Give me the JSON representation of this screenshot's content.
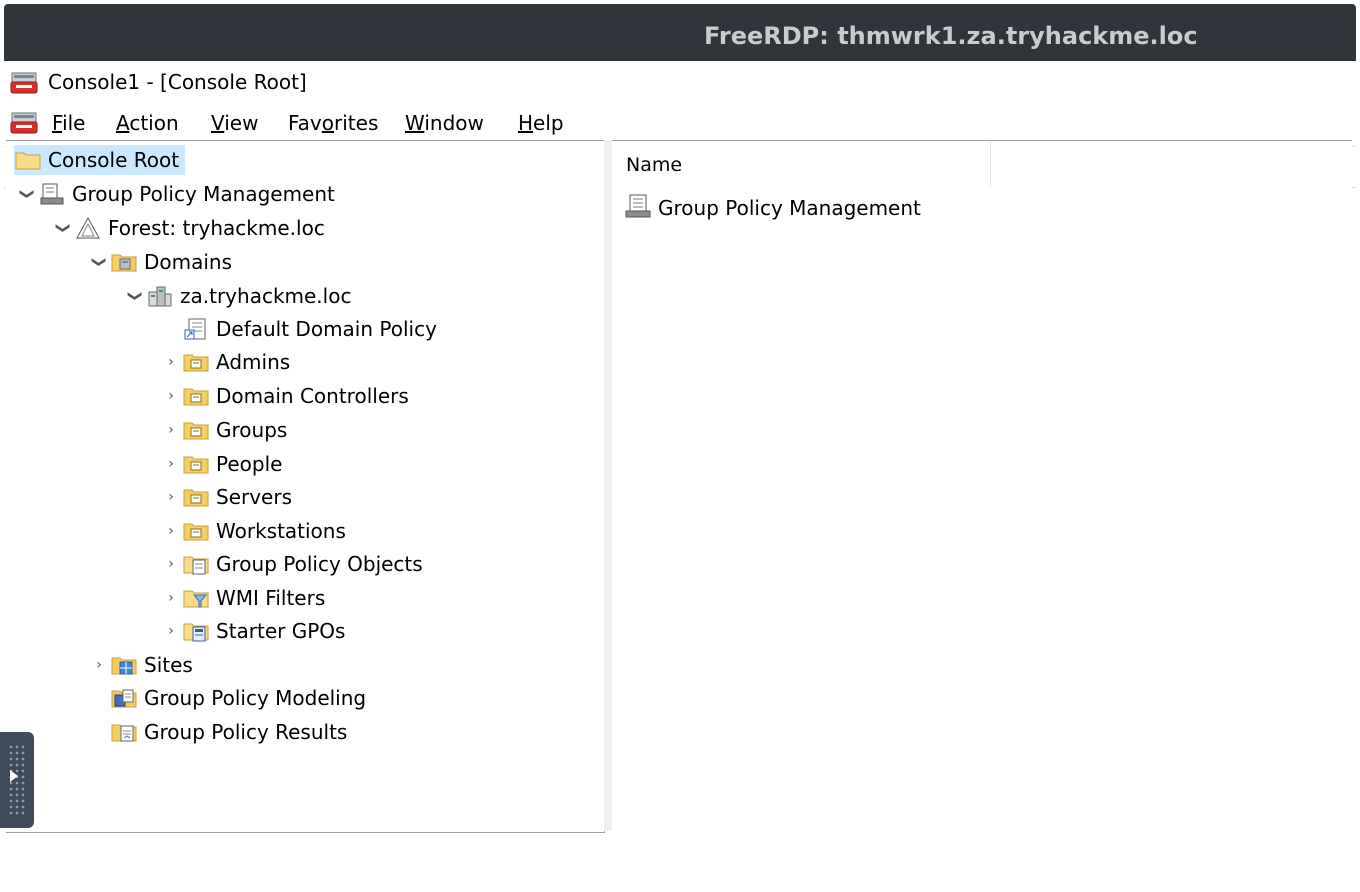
{
  "rdp": {
    "title": "FreeRDP: thmwrk1.za.tryhackme.loc"
  },
  "window": {
    "title": "Console1 - [Console Root]"
  },
  "menu": [
    {
      "label_underline": "F",
      "label_rest": "ile"
    },
    {
      "label_underline": "A",
      "label_rest": "ction"
    },
    {
      "label_underline": "V",
      "label_rest": "iew"
    },
    {
      "label_pre": "Fav",
      "label_underline": "o",
      "label_rest": "rites"
    },
    {
      "label_underline": "W",
      "label_rest": "indow"
    },
    {
      "label_underline": "H",
      "label_rest": "elp"
    }
  ],
  "toolbar": {
    "buttons": [
      "back-icon",
      "forward-icon",
      "show-hide-console-tree-icon",
      "export-list-icon",
      "help-icon",
      "show-hide-action-pane-icon"
    ]
  },
  "tree": {
    "root": "Console Root",
    "gpm": "Group Policy Management",
    "forest": "Forest: tryhackme.loc",
    "domains": "Domains",
    "domain": "za.tryhackme.loc",
    "default_policy": "Default Domain Policy",
    "ous": [
      "Admins",
      "Domain Controllers",
      "Groups",
      "People",
      "Servers",
      "Workstations"
    ],
    "gpo": "Group Policy Objects",
    "wmi": "WMI Filters",
    "starter": "Starter GPOs",
    "sites": "Sites",
    "modeling": "Group Policy Modeling",
    "results": "Group Policy Results"
  },
  "list": {
    "column_name": "Name",
    "items": [
      "Group Policy Management"
    ]
  },
  "colors": {
    "rdp_bar": "#30343b",
    "selection": "#cce8ff",
    "folder": "#f4cd63"
  }
}
